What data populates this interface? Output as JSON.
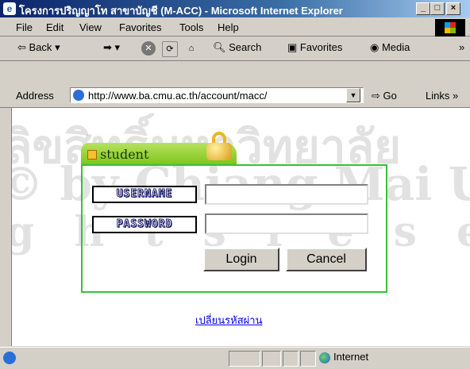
{
  "window": {
    "title": "โครงการปริญญาโท สาขาบัญชี (M-ACC) - Microsoft Internet Explorer",
    "minimize_label": "_",
    "maximize_label": "□",
    "close_label": "×"
  },
  "menu": {
    "items": [
      "File",
      "Edit",
      "View",
      "Favorites",
      "Tools",
      "Help"
    ]
  },
  "toolbar": {
    "back_label": "Back",
    "search_label": "Search",
    "favorites_label": "Favorites",
    "media_label": "Media"
  },
  "address": {
    "label": "Address",
    "url": "http://www.ba.cmu.ac.th/account/macc/",
    "go_label": "Go",
    "links_label": "Links"
  },
  "login": {
    "tab_title": "student",
    "username_label": "USERNAME",
    "password_label": "PASSWORD",
    "username_value": "",
    "password_value": "",
    "login_button": "Login",
    "cancel_button": "Cancel",
    "change_password_link": "เปลี่ยนรหัสผ่าน"
  },
  "watermark": {
    "line1": "© by Chiang Mai U",
    "line2": "g h t s r e s e"
  },
  "status": {
    "zone_label": "Internet"
  },
  "colors": {
    "titlebar": "#0a246a",
    "panel_border": "#35c235",
    "tab_green": "#7dc41b",
    "link": "#0000ff"
  }
}
